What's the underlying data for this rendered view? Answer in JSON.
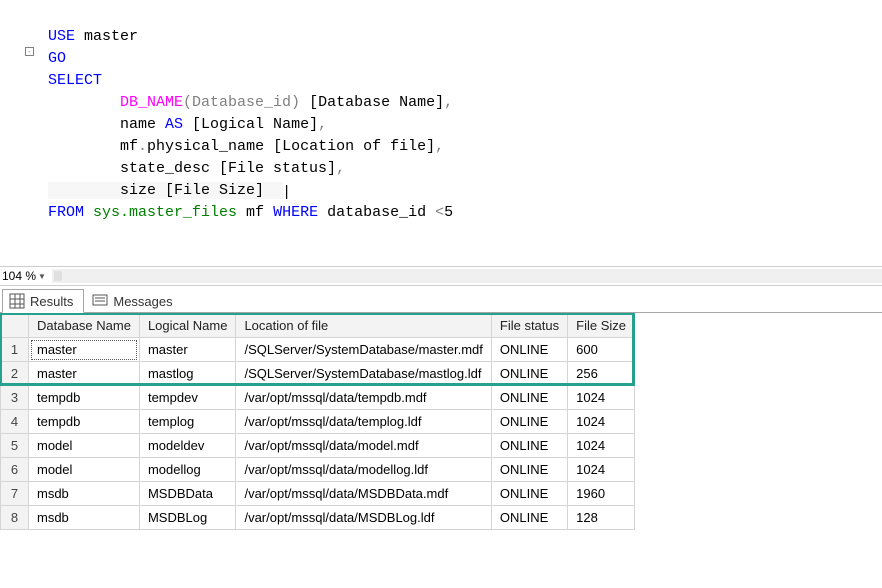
{
  "code": {
    "l1_kw": "USE",
    "l1_rest": " master",
    "l2_kw": "GO",
    "l3_kw": "SELECT",
    "l4_fn": "DB_NAME",
    "l4_rest_a": "(Database_id) ",
    "l4_rest_b": "[Database Name]",
    "l4_comma": ",",
    "l5_a": "name ",
    "l5_kw": "AS",
    "l5_b": " [Logical Name]",
    "l5_comma": ",",
    "l6_a": "mf",
    "l6_dot": ".",
    "l6_b": "physical_name [Location of file]",
    "l6_comma": ",",
    "l7": "state_desc [File status]",
    "l7_comma": ",",
    "l8_a": "size",
    "l8_b": " [File Size]  ",
    "l9_kw1": "FROM",
    "l9_obj": " sys.master_files",
    "l9_mid": " mf ",
    "l9_kw2": "WHERE",
    "l9_rest": " database_id ",
    "l9_op": "<",
    "l9_num": "5"
  },
  "zoom": {
    "value": "104 %"
  },
  "tabs": {
    "results": "Results",
    "messages": "Messages"
  },
  "grid": {
    "headers": [
      "Database Name",
      "Logical Name",
      "Location of file",
      "File status",
      "File Size"
    ],
    "rows": [
      {
        "n": "1",
        "c": [
          "master",
          "master",
          "/SQLServer/SystemDatabase/master.mdf",
          "ONLINE",
          "600"
        ]
      },
      {
        "n": "2",
        "c": [
          "master",
          "mastlog",
          "/SQLServer/SystemDatabase/mastlog.ldf",
          "ONLINE",
          "256"
        ]
      },
      {
        "n": "3",
        "c": [
          "tempdb",
          "tempdev",
          "/var/opt/mssql/data/tempdb.mdf",
          "ONLINE",
          "1024"
        ]
      },
      {
        "n": "4",
        "c": [
          "tempdb",
          "templog",
          "/var/opt/mssql/data/templog.ldf",
          "ONLINE",
          "1024"
        ]
      },
      {
        "n": "5",
        "c": [
          "model",
          "modeldev",
          "/var/opt/mssql/data/model.mdf",
          "ONLINE",
          "1024"
        ]
      },
      {
        "n": "6",
        "c": [
          "model",
          "modellog",
          "/var/opt/mssql/data/modellog.ldf",
          "ONLINE",
          "1024"
        ]
      },
      {
        "n": "7",
        "c": [
          "msdb",
          "MSDBData",
          "/var/opt/mssql/data/MSDBData.mdf",
          "ONLINE",
          "1960"
        ]
      },
      {
        "n": "8",
        "c": [
          "msdb",
          "MSDBLog",
          "/var/opt/mssql/data/MSDBLog.ldf",
          "ONLINE",
          "128"
        ]
      }
    ]
  }
}
